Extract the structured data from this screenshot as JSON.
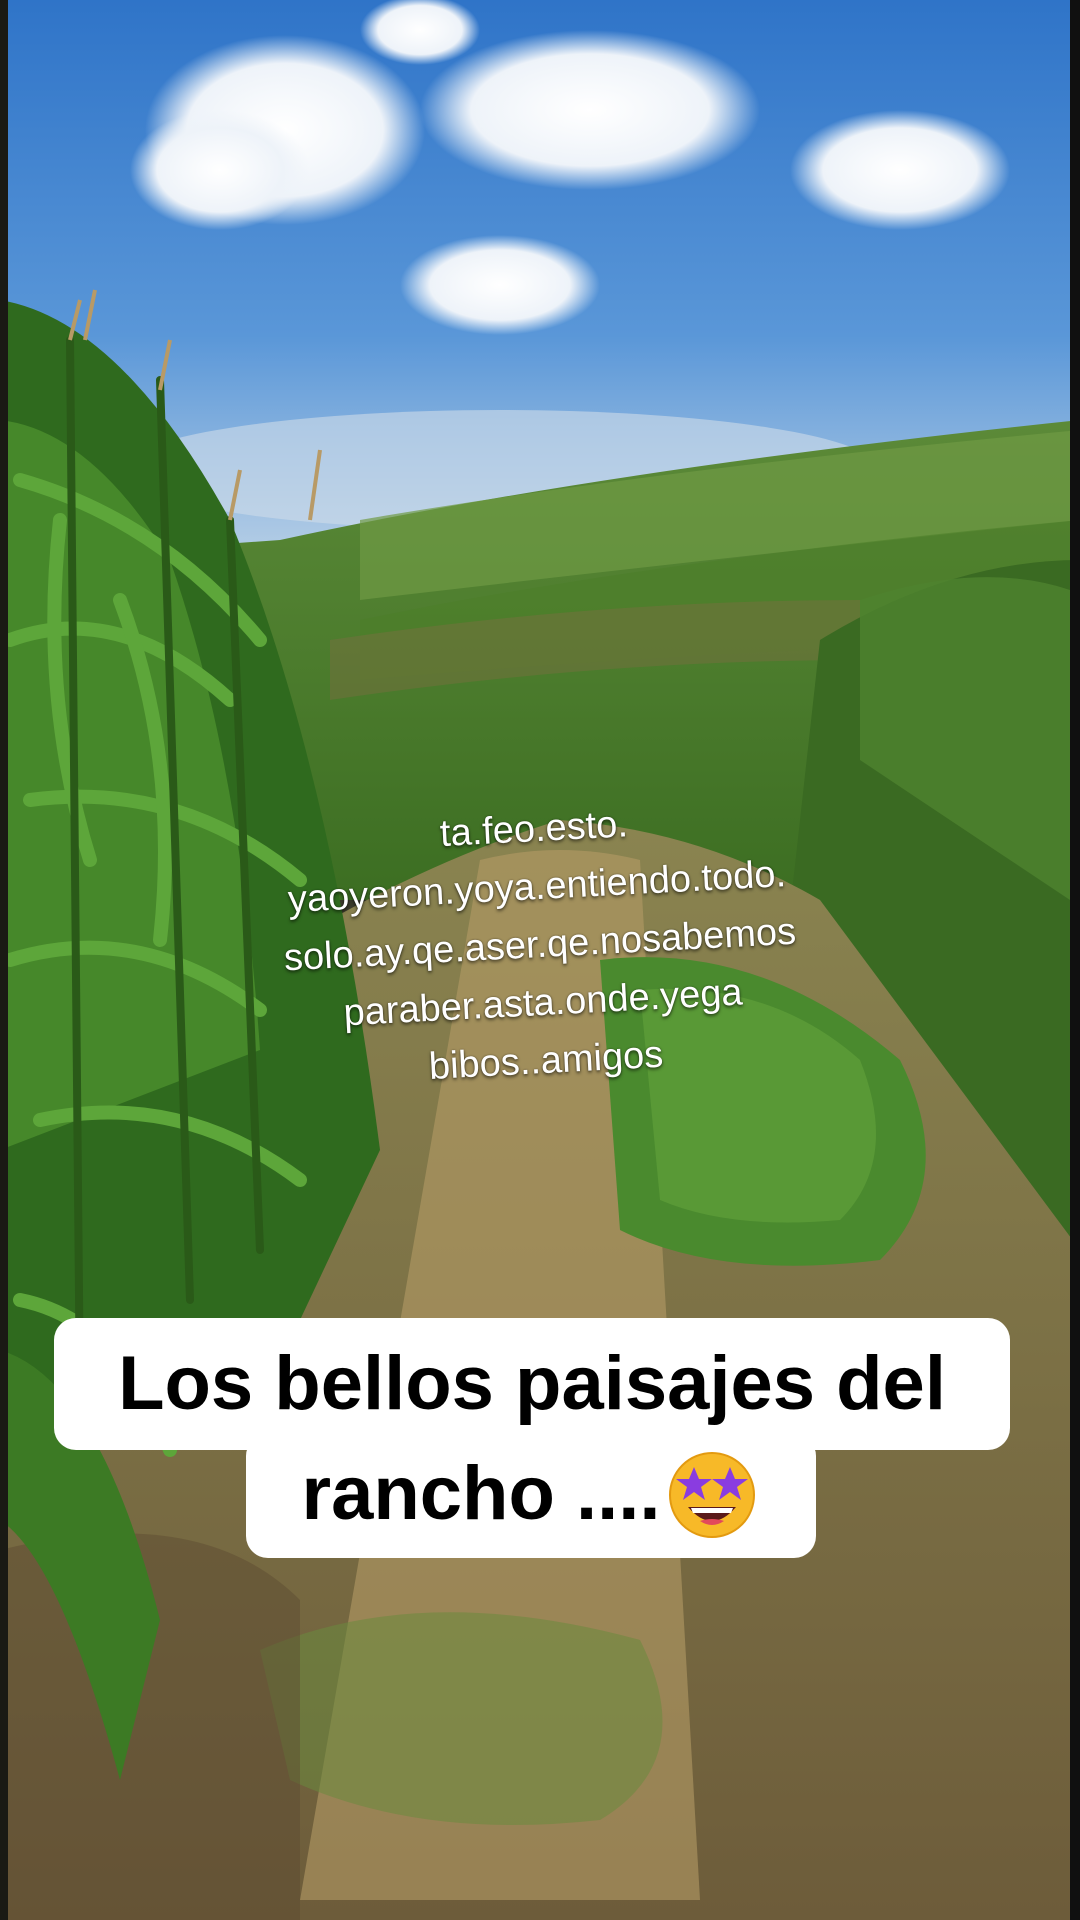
{
  "overlay_text": {
    "line1": "ta.feo.esto.",
    "line2": "yaoyeron.yoya.entiendo.todo.",
    "line3": "solo.ay.qe.aser.qe.nosabemos",
    "line4": "paraber.asta.onde.yega",
    "line5": "bibos..amigos"
  },
  "caption": {
    "line1": "Los bellos paisajes del",
    "line2": "rancho ....",
    "emoji": "star-struck-emoji"
  },
  "colors": {
    "sky": "#3f86d6",
    "field": "#4a8a2e",
    "path": "#a08a5a",
    "caption_bg": "#ffffff"
  }
}
